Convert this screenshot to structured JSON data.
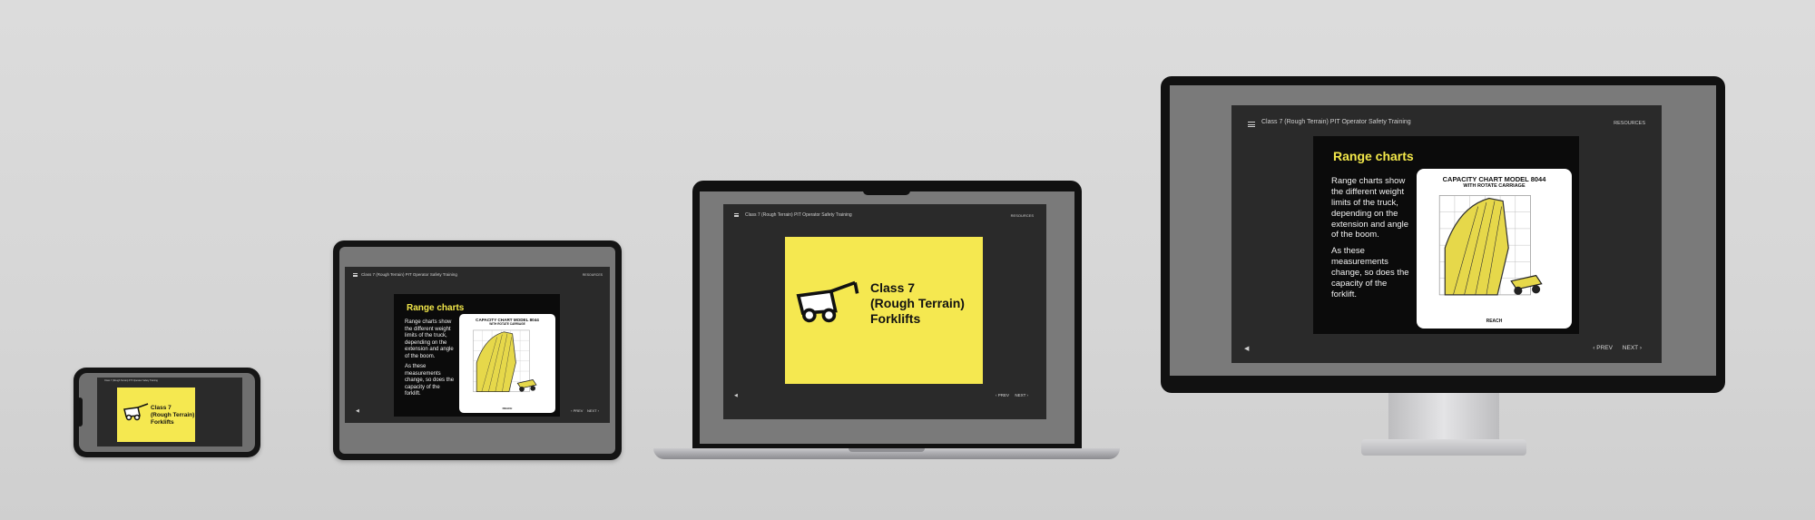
{
  "course": {
    "title": "Class 7 (Rough Terrain) PIT Operator Safety Training",
    "resources": "RESOURCES"
  },
  "cover_slide": {
    "line1": "Class 7",
    "line2": "(Rough Terrain)",
    "line3": "Forklifts"
  },
  "range_slide": {
    "title": "Range charts",
    "para1": "Range charts show the different weight limits of the truck, depending on the extension and angle of the boom.",
    "para2": "As these measurements change, so does the capacity of the forklift.",
    "chart_title": "CAPACITY CHART MODEL 8044",
    "chart_subtitle": "WITH ROTATE CARRIAGE",
    "chart_xlabel": "REACH"
  },
  "nav": {
    "prev": "PREV",
    "next": "NEXT"
  },
  "colors": {
    "accent_yellow": "#f5e850",
    "title_yellow": "#f3e84a",
    "app_dark": "#2a2a2a",
    "slide_black": "#0b0b0b"
  },
  "icons": [
    "menu-icon",
    "forklift-icon",
    "audio-icon",
    "chevron-left-icon",
    "chevron-right-icon"
  ]
}
